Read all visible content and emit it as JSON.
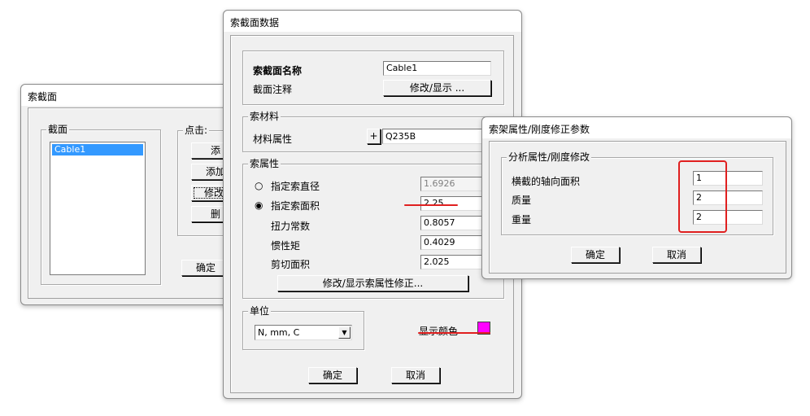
{
  "dialog_section": {
    "title": "索截面",
    "sections_legend": "截面",
    "sections_list": [
      "Cable1"
    ],
    "click_legend": "点击:",
    "buttons": [
      "添",
      "添加",
      "修改/",
      "删"
    ],
    "ok_label": "确定"
  },
  "dialog_cable": {
    "title": "索截面数据",
    "name_label": "索截面名称",
    "name_value": "Cable1",
    "note_label": "截面注释",
    "modify_show_button": "修改/显示 ...",
    "material_legend": "索材料",
    "material_prop_label": "材料属性",
    "material_plus": "+",
    "material_value": "Q235B",
    "props_legend": "索属性",
    "diameter_label": "指定索直径",
    "diameter_value": "1.6926",
    "area_label": "指定索面积",
    "area_value": "2.25",
    "torsion_label": "扭力常数",
    "torsion_value": "0.8057",
    "inertia_label": "惯性矩",
    "inertia_value": "0.4029",
    "shear_label": "剪切面积",
    "shear_value": "2.025",
    "modify_props_button": "修改/显示索属性修正...",
    "units_legend": "单位",
    "units_value": "N, mm, C",
    "display_color_label": "显示颜色",
    "display_color": "#ff00ff",
    "ok_label": "确定",
    "cancel_label": "取消"
  },
  "dialog_modifiers": {
    "title": "索架属性/刚度修正参数",
    "legend": "分析属性/刚度修改",
    "area_label": "横截的轴向面积",
    "area_value": "1",
    "mass_label": "质量",
    "mass_value": "2",
    "weight_label": "重量",
    "weight_value": "2",
    "ok_label": "确定",
    "cancel_label": "取消"
  },
  "colors": {
    "highlight_red": "#e02020",
    "selection_blue": "#3399ff"
  }
}
